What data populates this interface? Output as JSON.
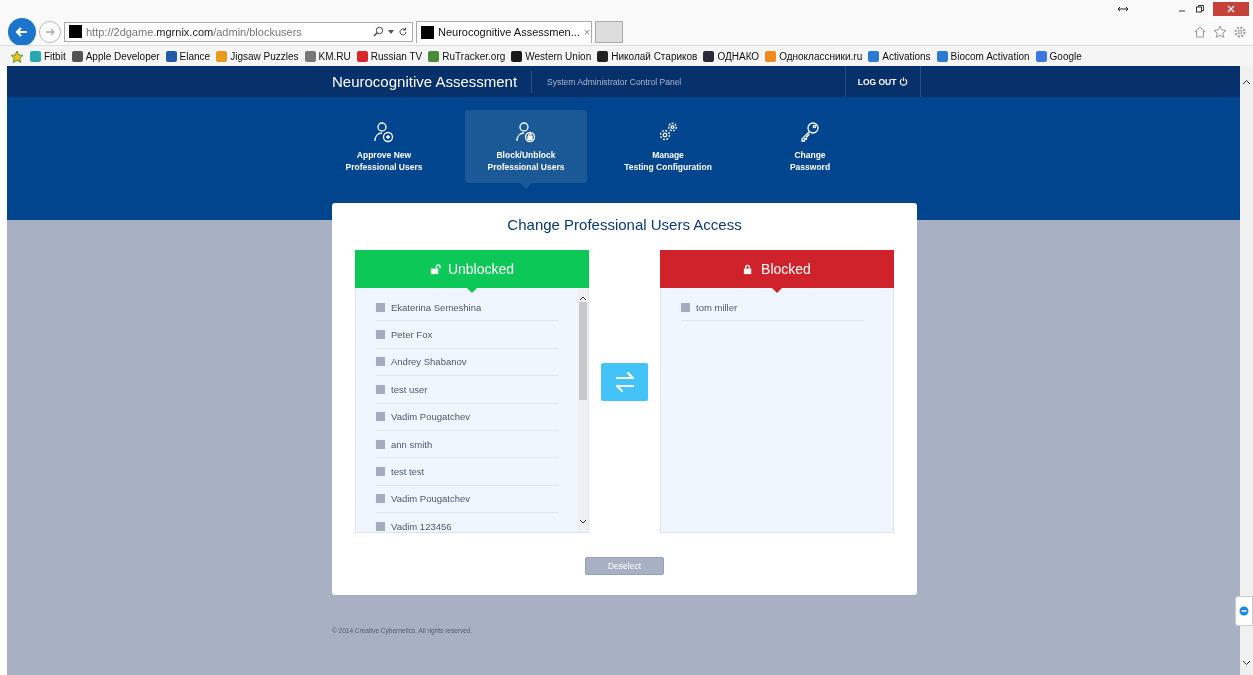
{
  "browser": {
    "url_prefix": "http://2dgame.",
    "url_domain": "mgrnix.com",
    "url_path": "/admin/blockusers",
    "tab_title": "Neurocognitive Assessmen...",
    "tab_close": "×",
    "bookmarks": [
      {
        "label": "Fitbit",
        "color": "#2aa8b0"
      },
      {
        "label": "Apple Developer",
        "color": "#555555"
      },
      {
        "label": "Elance",
        "color": "#1e5aa8"
      },
      {
        "label": "Jigsaw Puzzles",
        "color": "#e89a1c"
      },
      {
        "label": "KM.RU",
        "color": "#777777"
      },
      {
        "label": "Russian TV",
        "color": "#d8262c"
      },
      {
        "label": "RuTracker.org",
        "color": "#4a8a3a"
      },
      {
        "label": "Western Union",
        "color": "#1a1a1a"
      },
      {
        "label": "Николай Стариков",
        "color": "#222222"
      },
      {
        "label": "ОДНАКО",
        "color": "#2a2a3a"
      },
      {
        "label": "Одноклассники.ru",
        "color": "#f08a1c"
      },
      {
        "label": "Activations",
        "color": "#2a7ad0"
      },
      {
        "label": "Biocom Activation",
        "color": "#2a7ad0"
      },
      {
        "label": "Google",
        "color": "#3a78e0"
      }
    ]
  },
  "header": {
    "title": "Neurocognitive Assessment",
    "subtitle": "System Administrator Control Panel",
    "logout": "LOG OUT"
  },
  "nav": [
    {
      "kind": "add-user",
      "line1": "Approve New",
      "line2": "Professional Users",
      "selected": false
    },
    {
      "kind": "lock-user",
      "line1": "Block/Unblock",
      "line2": "Professional Users",
      "selected": true
    },
    {
      "kind": "gears",
      "line1": "Manage",
      "line2": "Testing Configuration",
      "selected": false
    },
    {
      "kind": "key",
      "line1": "Change",
      "line2": "Password",
      "selected": false
    }
  ],
  "card": {
    "title": "Change Professional Users Access",
    "deselect": "Deselect",
    "unblocked": {
      "label": "Unblocked",
      "users": [
        {
          "name": "Ekaterina Semeshina",
          "checked": false
        },
        {
          "name": "Peter Fox",
          "checked": false
        },
        {
          "name": "Andrey Shabanov",
          "checked": false
        },
        {
          "name": "test user",
          "checked": false
        },
        {
          "name": "Vadim Pougatchev",
          "checked": false
        },
        {
          "name": "ann smith",
          "checked": false
        },
        {
          "name": "test test",
          "checked": false
        },
        {
          "name": "Vadim Pougatchev",
          "checked": false
        },
        {
          "name": "Vadim 123456",
          "checked": false
        }
      ]
    },
    "blocked": {
      "label": "Blocked",
      "users": [
        {
          "name": "tom miller",
          "checked": false
        }
      ]
    }
  },
  "footer": "© 2014 Creative Cybernetics. All rights reserved."
}
